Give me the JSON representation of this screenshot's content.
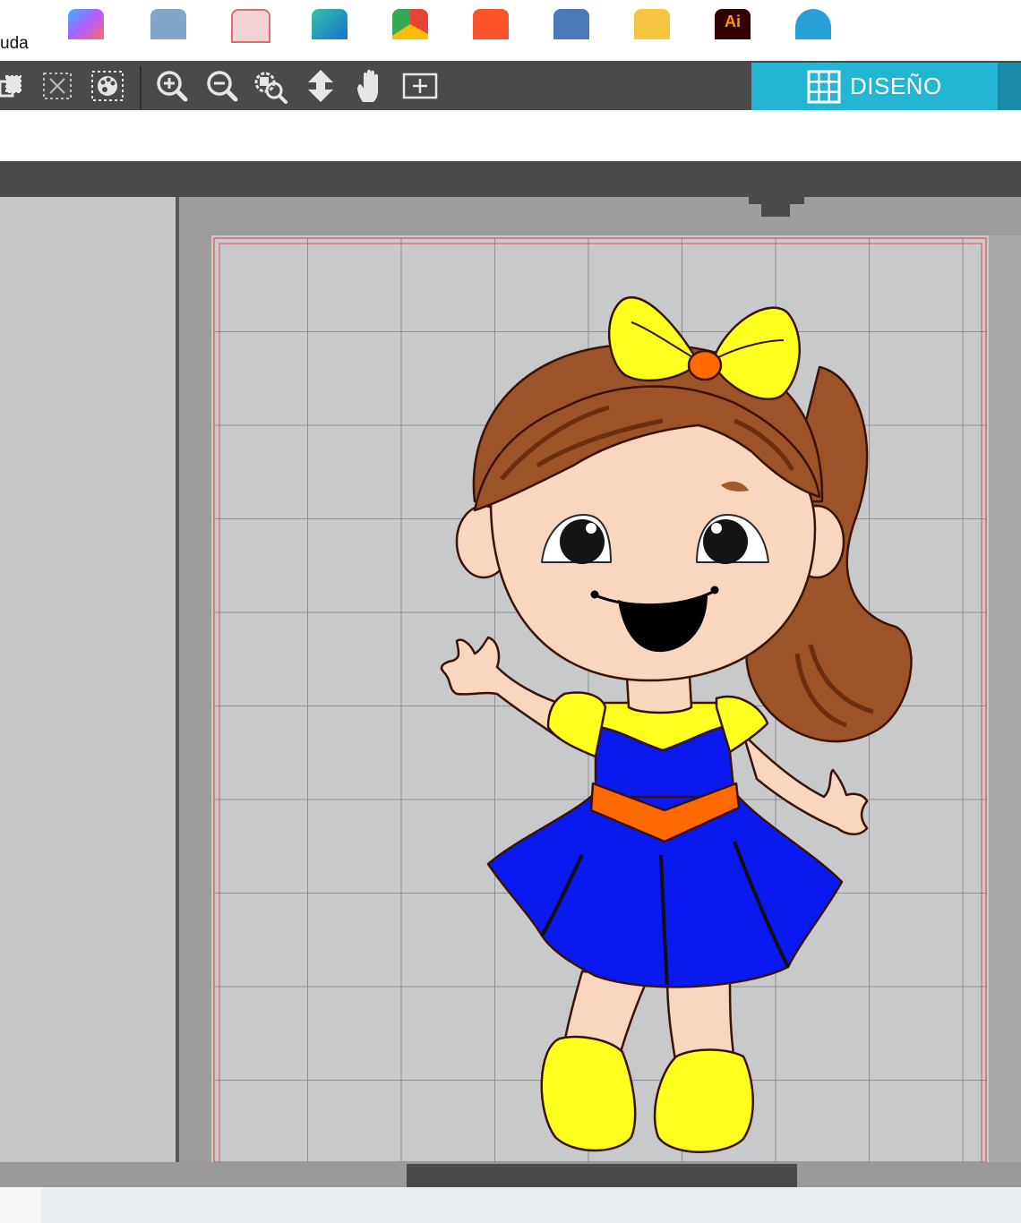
{
  "menu": {
    "visible_item": "uda"
  },
  "toolbar": {
    "tools": [
      "group-icon",
      "ungroup-icon",
      "color-palette-icon",
      "zoom-in-icon",
      "zoom-out-icon",
      "zoom-fit-icon",
      "pan-vertical-icon",
      "hand-pan-icon",
      "fit-page-icon"
    ]
  },
  "design_tab": {
    "label": "DISEÑO",
    "icon": "grid-icon",
    "color": "#23b5d3"
  },
  "canvas": {
    "background": "#c8c9cb",
    "grid_color": "#8e8f93",
    "margin_color": "#e05050"
  },
  "artwork": {
    "subject": "girl-illustration",
    "colors": {
      "hair": "#9b5327",
      "hair_dark": "#6a2e10",
      "skin": "#fad6bf",
      "bow": "#ffff1f",
      "bow_knot": "#ff6a00",
      "dress": "#0a19f0",
      "bodice_top": "#ffff1f",
      "belt": "#ff6a00",
      "shoes": "#ffff1f"
    }
  },
  "taskbar": {
    "apps": [
      "copilot-icon",
      "notepad-icon",
      "pdf-reader-icon",
      "edge-icon",
      "chrome-icon",
      "brave-icon",
      "calculator-icon",
      "file-explorer-icon",
      "illustrator-icon",
      "silhouette-studio-icon"
    ],
    "illustrator_label": "Ai"
  }
}
